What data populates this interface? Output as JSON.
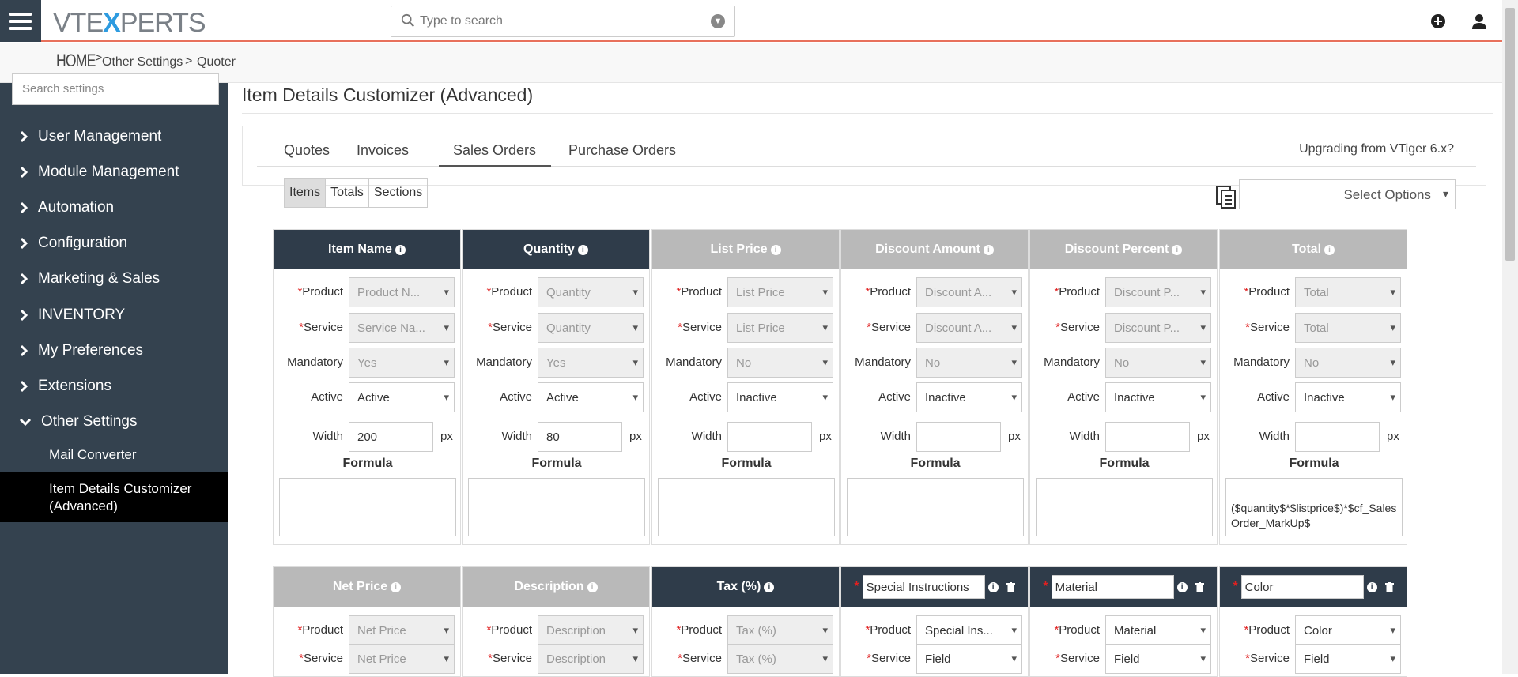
{
  "header": {
    "logo_left": "VTE",
    "logo_x": "X",
    "logo_right": "PERTS",
    "search_placeholder": "Type to search"
  },
  "breadcrumb": {
    "home": "HOME",
    "sep1": ">",
    "item1": "Other Settings",
    "sep2": ">",
    "item2": "Quoter"
  },
  "sidebar": {
    "search_placeholder": "Search settings",
    "items": [
      "User Management",
      "Module Management",
      "Automation",
      "Configuration",
      "Marketing & Sales",
      "INVENTORY",
      "My Preferences",
      "Extensions",
      "Other Settings"
    ],
    "subitems": [
      "Mail Converter",
      "Item Details Customizer (Advanced)"
    ]
  },
  "page": {
    "title": "Item Details Customizer (Advanced)",
    "tabs": [
      "Quotes",
      "Invoices",
      "Sales Orders",
      "Purchase Orders"
    ],
    "active_tab": "Sales Orders",
    "upgrade_link": "Upgrading from VTiger 6.x?",
    "segments": [
      "Items",
      "Totals",
      "Sections"
    ],
    "active_segment": "Items",
    "select_options": "Select Options"
  },
  "labels": {
    "product": "Product",
    "service": "Service",
    "mandatory": "Mandatory",
    "active": "Active",
    "width": "Width",
    "px": "px",
    "formula": "Formula",
    "req": "*"
  },
  "columns": [
    {
      "title": "Item Name",
      "style": "dark",
      "product": "Product N...",
      "service": "Service Na...",
      "mandatory": "Yes",
      "active": "Active",
      "width": "200",
      "formula": ""
    },
    {
      "title": "Quantity",
      "style": "dark",
      "product": "Quantity",
      "service": "Quantity",
      "mandatory": "Yes",
      "active": "Active",
      "width": "80",
      "formula": ""
    },
    {
      "title": "List Price",
      "style": "grey",
      "product": "List Price",
      "service": "List Price",
      "mandatory": "No",
      "active": "Inactive",
      "width": "",
      "formula": ""
    },
    {
      "title": "Discount Amount",
      "style": "grey",
      "product": "Discount A...",
      "service": "Discount A...",
      "mandatory": "No",
      "active": "Inactive",
      "width": "",
      "formula": ""
    },
    {
      "title": "Discount Percent",
      "style": "grey",
      "product": "Discount P...",
      "service": "Discount P...",
      "mandatory": "No",
      "active": "Inactive",
      "width": "",
      "formula": ""
    },
    {
      "title": "Total",
      "style": "grey",
      "product": "Total",
      "service": "Total",
      "mandatory": "No",
      "active": "Inactive",
      "width": "",
      "formula": "($quantity$*$listprice$)*$cf_SalesOrder_MarkUp$"
    }
  ],
  "columns2": [
    {
      "title": "Net Price",
      "style": "grey",
      "product": "Net Price",
      "service": "Net Price"
    },
    {
      "title": "Description",
      "style": "grey",
      "product": "Description",
      "service": "Description"
    },
    {
      "title": "Tax (%)",
      "style": "dark",
      "product": "Tax (%)",
      "service": "Tax (%)"
    },
    {
      "title": "Special Instructions",
      "style": "custom",
      "product": "Special Ins...",
      "service": "Field"
    },
    {
      "title": "Material",
      "style": "custom",
      "product": "Material",
      "service": "Field"
    },
    {
      "title": "Color",
      "style": "custom",
      "product": "Color",
      "service": "Field"
    }
  ]
}
